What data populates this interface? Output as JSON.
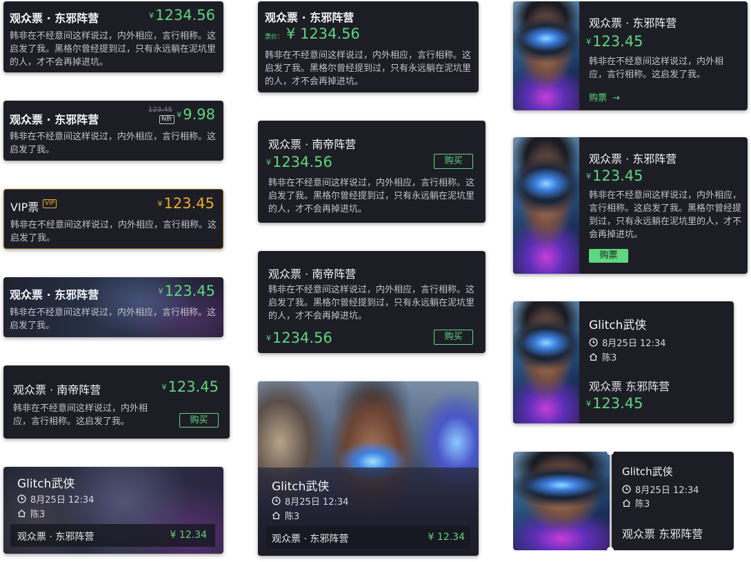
{
  "symbols": {
    "currency": "¥",
    "arrow": "→"
  },
  "cards": {
    "c1": {
      "title": "观众票 · 东邪阵营",
      "price": "1234.56",
      "desc": "韩非在不经意间这样说过，内外相应，言行相称。这启发了我。黑格尔曾经提到过，只有永远躺在泥坑里的人，才不会再掉进坑。"
    },
    "c2": {
      "title": "观众票 · 东邪阵营",
      "old_price": "123.45",
      "discount_badge": "N折",
      "price": "9.98",
      "desc": "韩非在不经意间这样说过，内外相应，言行相称。这启发了我。"
    },
    "c3": {
      "title": "VIP票",
      "vip_badge": "VIP",
      "price": "123.45",
      "desc": "韩非在不经意间这样说过，内外相应，言行相称。这启发了我。"
    },
    "c4": {
      "title": "观众票 · 东邪阵营",
      "price": "123.45",
      "desc": "韩非在不经意间这样说过，内外相应，言行相称。这启发了我。"
    },
    "c5": {
      "title": "观众票 · 南帝阵营",
      "price": "123.45",
      "desc": "韩非在不经意间这样说过，内外相应，言行相称。这启发了我。",
      "button": "购买"
    },
    "c6": {
      "movie": "Glitch武侠",
      "datetime": "8月25日 12:34",
      "hall": "陈3",
      "ticket": "观众票 · 东邪阵营",
      "price": "12.34"
    },
    "c7": {
      "title": "观众票 · 东邪阵营",
      "price_label": "票价：",
      "price": "1234.56",
      "desc": "韩非在不经意间这样说过，内外相应，言行相称。这启发了我。黑格尔曾经提到过，只有永远躺在泥坑里的人，才不会再掉进坑。"
    },
    "c8": {
      "title": "观众票 · 南帝阵营",
      "price": "1234.56",
      "button": "购买",
      "desc": "韩非在不经意间这样说过，内外相应，言行相称。这启发了我。黑格尔曾经提到过，只有永远躺在泥坑里的人，才不会再掉进坑。"
    },
    "c9": {
      "title": "观众票 · 南帝阵营",
      "desc": "韩非在不经意间这样说过，内外相应，言行相称。这启发了我。黑格尔曾经提到过，只有永远躺在泥坑里的人，才不会再掉进坑。",
      "price": "1234.56",
      "button": "购买"
    },
    "c10": {
      "movie": "Glitch武侠",
      "datetime": "8月25日 12:34",
      "hall": "陈3",
      "ticket": "观众票 · 东邪阵营",
      "price": "12.34"
    },
    "c11": {
      "title": "观众票 · 东邪阵营",
      "price": "123.45",
      "desc": "韩非在不经意间这样说过，内外相应，言行相称。这启发了我。",
      "link": "购票"
    },
    "c12": {
      "title": "观众票 · 东邪阵营",
      "price": "123.45",
      "desc": "韩非在不经意间这样说过，内外相应，言行相称。这启发了我。黑格尔曾经提到过，只有永远躺在泥坑里的人，才不会再掉进坑。",
      "button": "购票"
    },
    "c13": {
      "movie": "Glitch武侠",
      "datetime": "8月25日 12:34",
      "hall": "陈3",
      "ticket": "观众票 东邪阵营",
      "price": "123.45"
    },
    "c14": {
      "movie": "Glitch武侠",
      "datetime": "8月25日 12:34",
      "hall": "陈3",
      "ticket": "观众票 东邪阵营"
    }
  },
  "colors": {
    "card_bg": "#1d1e25",
    "accent_green": "#5fd67f",
    "vip_gold": "#ecab2d",
    "text": "#f4f5f8",
    "muted": "#c1c4cc"
  }
}
